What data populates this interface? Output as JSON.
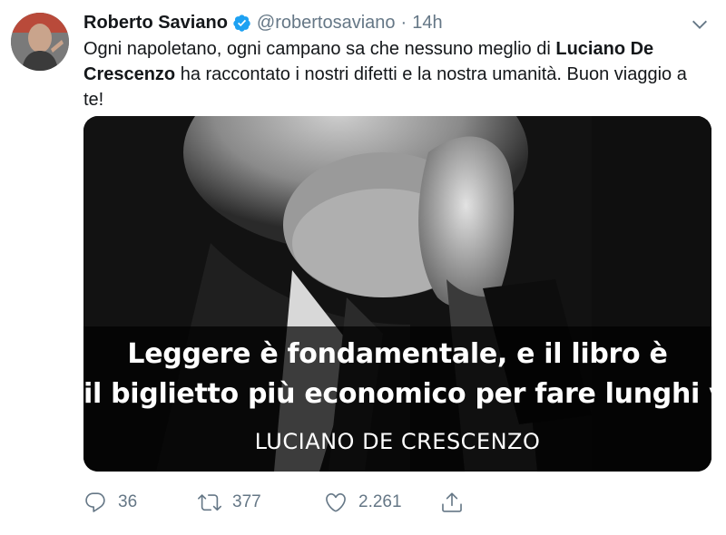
{
  "tweet": {
    "author_name": "Roberto Saviano",
    "verified_icon": "verified-badge-icon",
    "handle": "@robertosaviano",
    "separator": "·",
    "time": "14h",
    "text_part1": "Ogni napoletano, ogni campano sa che nessuno meglio di ",
    "text_bold": "Luciano De Crescenzo",
    "text_part2": " ha raccontato i nostri difetti e la nostra umanità. Buon viaggio a te!",
    "media": {
      "quote_line1": "Leggere è fondamentale, e il libro è",
      "quote_line2": "il biglietto più economico per fare lunghi viaggi.",
      "quote_author": "LUCIANO DE CRESCENZO"
    },
    "actions": {
      "replies": "36",
      "retweets": "377",
      "likes": "2.261"
    }
  },
  "colors": {
    "text": "#14171a",
    "secondary": "#657786",
    "verified": "#1da1f2"
  }
}
